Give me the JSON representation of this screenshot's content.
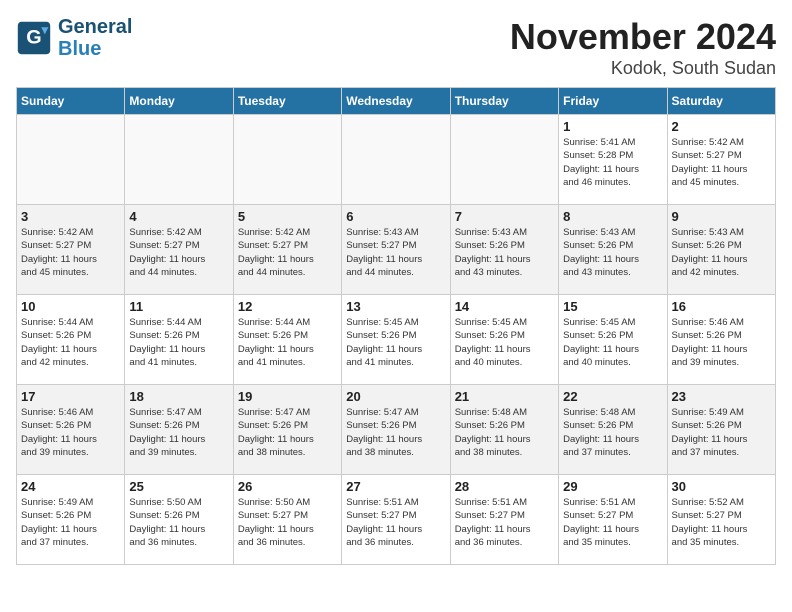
{
  "header": {
    "logo_line1": "General",
    "logo_line2": "Blue",
    "month": "November 2024",
    "location": "Kodok, South Sudan"
  },
  "weekdays": [
    "Sunday",
    "Monday",
    "Tuesday",
    "Wednesday",
    "Thursday",
    "Friday",
    "Saturday"
  ],
  "weeks": [
    [
      {
        "day": "",
        "info": "",
        "empty": true
      },
      {
        "day": "",
        "info": "",
        "empty": true
      },
      {
        "day": "",
        "info": "",
        "empty": true
      },
      {
        "day": "",
        "info": "",
        "empty": true
      },
      {
        "day": "",
        "info": "",
        "empty": true
      },
      {
        "day": "1",
        "info": "Sunrise: 5:41 AM\nSunset: 5:28 PM\nDaylight: 11 hours\nand 46 minutes.",
        "empty": false
      },
      {
        "day": "2",
        "info": "Sunrise: 5:42 AM\nSunset: 5:27 PM\nDaylight: 11 hours\nand 45 minutes.",
        "empty": false
      }
    ],
    [
      {
        "day": "3",
        "info": "Sunrise: 5:42 AM\nSunset: 5:27 PM\nDaylight: 11 hours\nand 45 minutes.",
        "empty": false
      },
      {
        "day": "4",
        "info": "Sunrise: 5:42 AM\nSunset: 5:27 PM\nDaylight: 11 hours\nand 44 minutes.",
        "empty": false
      },
      {
        "day": "5",
        "info": "Sunrise: 5:42 AM\nSunset: 5:27 PM\nDaylight: 11 hours\nand 44 minutes.",
        "empty": false
      },
      {
        "day": "6",
        "info": "Sunrise: 5:43 AM\nSunset: 5:27 PM\nDaylight: 11 hours\nand 44 minutes.",
        "empty": false
      },
      {
        "day": "7",
        "info": "Sunrise: 5:43 AM\nSunset: 5:26 PM\nDaylight: 11 hours\nand 43 minutes.",
        "empty": false
      },
      {
        "day": "8",
        "info": "Sunrise: 5:43 AM\nSunset: 5:26 PM\nDaylight: 11 hours\nand 43 minutes.",
        "empty": false
      },
      {
        "day": "9",
        "info": "Sunrise: 5:43 AM\nSunset: 5:26 PM\nDaylight: 11 hours\nand 42 minutes.",
        "empty": false
      }
    ],
    [
      {
        "day": "10",
        "info": "Sunrise: 5:44 AM\nSunset: 5:26 PM\nDaylight: 11 hours\nand 42 minutes.",
        "empty": false
      },
      {
        "day": "11",
        "info": "Sunrise: 5:44 AM\nSunset: 5:26 PM\nDaylight: 11 hours\nand 41 minutes.",
        "empty": false
      },
      {
        "day": "12",
        "info": "Sunrise: 5:44 AM\nSunset: 5:26 PM\nDaylight: 11 hours\nand 41 minutes.",
        "empty": false
      },
      {
        "day": "13",
        "info": "Sunrise: 5:45 AM\nSunset: 5:26 PM\nDaylight: 11 hours\nand 41 minutes.",
        "empty": false
      },
      {
        "day": "14",
        "info": "Sunrise: 5:45 AM\nSunset: 5:26 PM\nDaylight: 11 hours\nand 40 minutes.",
        "empty": false
      },
      {
        "day": "15",
        "info": "Sunrise: 5:45 AM\nSunset: 5:26 PM\nDaylight: 11 hours\nand 40 minutes.",
        "empty": false
      },
      {
        "day": "16",
        "info": "Sunrise: 5:46 AM\nSunset: 5:26 PM\nDaylight: 11 hours\nand 39 minutes.",
        "empty": false
      }
    ],
    [
      {
        "day": "17",
        "info": "Sunrise: 5:46 AM\nSunset: 5:26 PM\nDaylight: 11 hours\nand 39 minutes.",
        "empty": false
      },
      {
        "day": "18",
        "info": "Sunrise: 5:47 AM\nSunset: 5:26 PM\nDaylight: 11 hours\nand 39 minutes.",
        "empty": false
      },
      {
        "day": "19",
        "info": "Sunrise: 5:47 AM\nSunset: 5:26 PM\nDaylight: 11 hours\nand 38 minutes.",
        "empty": false
      },
      {
        "day": "20",
        "info": "Sunrise: 5:47 AM\nSunset: 5:26 PM\nDaylight: 11 hours\nand 38 minutes.",
        "empty": false
      },
      {
        "day": "21",
        "info": "Sunrise: 5:48 AM\nSunset: 5:26 PM\nDaylight: 11 hours\nand 38 minutes.",
        "empty": false
      },
      {
        "day": "22",
        "info": "Sunrise: 5:48 AM\nSunset: 5:26 PM\nDaylight: 11 hours\nand 37 minutes.",
        "empty": false
      },
      {
        "day": "23",
        "info": "Sunrise: 5:49 AM\nSunset: 5:26 PM\nDaylight: 11 hours\nand 37 minutes.",
        "empty": false
      }
    ],
    [
      {
        "day": "24",
        "info": "Sunrise: 5:49 AM\nSunset: 5:26 PM\nDaylight: 11 hours\nand 37 minutes.",
        "empty": false
      },
      {
        "day": "25",
        "info": "Sunrise: 5:50 AM\nSunset: 5:26 PM\nDaylight: 11 hours\nand 36 minutes.",
        "empty": false
      },
      {
        "day": "26",
        "info": "Sunrise: 5:50 AM\nSunset: 5:27 PM\nDaylight: 11 hours\nand 36 minutes.",
        "empty": false
      },
      {
        "day": "27",
        "info": "Sunrise: 5:51 AM\nSunset: 5:27 PM\nDaylight: 11 hours\nand 36 minutes.",
        "empty": false
      },
      {
        "day": "28",
        "info": "Sunrise: 5:51 AM\nSunset: 5:27 PM\nDaylight: 11 hours\nand 36 minutes.",
        "empty": false
      },
      {
        "day": "29",
        "info": "Sunrise: 5:51 AM\nSunset: 5:27 PM\nDaylight: 11 hours\nand 35 minutes.",
        "empty": false
      },
      {
        "day": "30",
        "info": "Sunrise: 5:52 AM\nSunset: 5:27 PM\nDaylight: 11 hours\nand 35 minutes.",
        "empty": false
      }
    ]
  ]
}
